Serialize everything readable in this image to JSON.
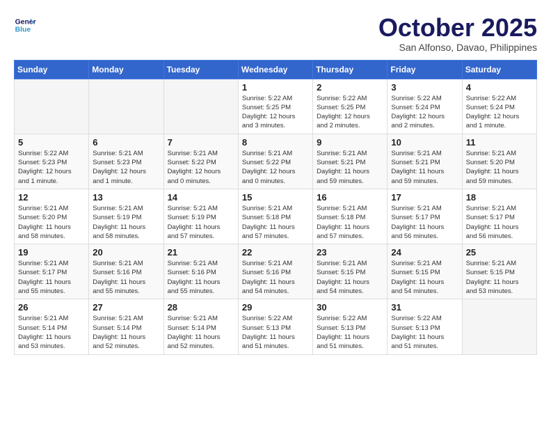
{
  "header": {
    "logo_line1": "General",
    "logo_line2": "Blue",
    "month": "October 2025",
    "location": "San Alfonso, Davao, Philippines"
  },
  "weekdays": [
    "Sunday",
    "Monday",
    "Tuesday",
    "Wednesday",
    "Thursday",
    "Friday",
    "Saturday"
  ],
  "weeks": [
    [
      {
        "day": "",
        "info": ""
      },
      {
        "day": "",
        "info": ""
      },
      {
        "day": "",
        "info": ""
      },
      {
        "day": "1",
        "info": "Sunrise: 5:22 AM\nSunset: 5:25 PM\nDaylight: 12 hours\nand 3 minutes."
      },
      {
        "day": "2",
        "info": "Sunrise: 5:22 AM\nSunset: 5:25 PM\nDaylight: 12 hours\nand 2 minutes."
      },
      {
        "day": "3",
        "info": "Sunrise: 5:22 AM\nSunset: 5:24 PM\nDaylight: 12 hours\nand 2 minutes."
      },
      {
        "day": "4",
        "info": "Sunrise: 5:22 AM\nSunset: 5:24 PM\nDaylight: 12 hours\nand 1 minute."
      }
    ],
    [
      {
        "day": "5",
        "info": "Sunrise: 5:22 AM\nSunset: 5:23 PM\nDaylight: 12 hours\nand 1 minute."
      },
      {
        "day": "6",
        "info": "Sunrise: 5:21 AM\nSunset: 5:23 PM\nDaylight: 12 hours\nand 1 minute."
      },
      {
        "day": "7",
        "info": "Sunrise: 5:21 AM\nSunset: 5:22 PM\nDaylight: 12 hours\nand 0 minutes."
      },
      {
        "day": "8",
        "info": "Sunrise: 5:21 AM\nSunset: 5:22 PM\nDaylight: 12 hours\nand 0 minutes."
      },
      {
        "day": "9",
        "info": "Sunrise: 5:21 AM\nSunset: 5:21 PM\nDaylight: 11 hours\nand 59 minutes."
      },
      {
        "day": "10",
        "info": "Sunrise: 5:21 AM\nSunset: 5:21 PM\nDaylight: 11 hours\nand 59 minutes."
      },
      {
        "day": "11",
        "info": "Sunrise: 5:21 AM\nSunset: 5:20 PM\nDaylight: 11 hours\nand 59 minutes."
      }
    ],
    [
      {
        "day": "12",
        "info": "Sunrise: 5:21 AM\nSunset: 5:20 PM\nDaylight: 11 hours\nand 58 minutes."
      },
      {
        "day": "13",
        "info": "Sunrise: 5:21 AM\nSunset: 5:19 PM\nDaylight: 11 hours\nand 58 minutes."
      },
      {
        "day": "14",
        "info": "Sunrise: 5:21 AM\nSunset: 5:19 PM\nDaylight: 11 hours\nand 57 minutes."
      },
      {
        "day": "15",
        "info": "Sunrise: 5:21 AM\nSunset: 5:18 PM\nDaylight: 11 hours\nand 57 minutes."
      },
      {
        "day": "16",
        "info": "Sunrise: 5:21 AM\nSunset: 5:18 PM\nDaylight: 11 hours\nand 57 minutes."
      },
      {
        "day": "17",
        "info": "Sunrise: 5:21 AM\nSunset: 5:17 PM\nDaylight: 11 hours\nand 56 minutes."
      },
      {
        "day": "18",
        "info": "Sunrise: 5:21 AM\nSunset: 5:17 PM\nDaylight: 11 hours\nand 56 minutes."
      }
    ],
    [
      {
        "day": "19",
        "info": "Sunrise: 5:21 AM\nSunset: 5:17 PM\nDaylight: 11 hours\nand 55 minutes."
      },
      {
        "day": "20",
        "info": "Sunrise: 5:21 AM\nSunset: 5:16 PM\nDaylight: 11 hours\nand 55 minutes."
      },
      {
        "day": "21",
        "info": "Sunrise: 5:21 AM\nSunset: 5:16 PM\nDaylight: 11 hours\nand 55 minutes."
      },
      {
        "day": "22",
        "info": "Sunrise: 5:21 AM\nSunset: 5:16 PM\nDaylight: 11 hours\nand 54 minutes."
      },
      {
        "day": "23",
        "info": "Sunrise: 5:21 AM\nSunset: 5:15 PM\nDaylight: 11 hours\nand 54 minutes."
      },
      {
        "day": "24",
        "info": "Sunrise: 5:21 AM\nSunset: 5:15 PM\nDaylight: 11 hours\nand 54 minutes."
      },
      {
        "day": "25",
        "info": "Sunrise: 5:21 AM\nSunset: 5:15 PM\nDaylight: 11 hours\nand 53 minutes."
      }
    ],
    [
      {
        "day": "26",
        "info": "Sunrise: 5:21 AM\nSunset: 5:14 PM\nDaylight: 11 hours\nand 53 minutes."
      },
      {
        "day": "27",
        "info": "Sunrise: 5:21 AM\nSunset: 5:14 PM\nDaylight: 11 hours\nand 52 minutes."
      },
      {
        "day": "28",
        "info": "Sunrise: 5:21 AM\nSunset: 5:14 PM\nDaylight: 11 hours\nand 52 minutes."
      },
      {
        "day": "29",
        "info": "Sunrise: 5:22 AM\nSunset: 5:13 PM\nDaylight: 11 hours\nand 51 minutes."
      },
      {
        "day": "30",
        "info": "Sunrise: 5:22 AM\nSunset: 5:13 PM\nDaylight: 11 hours\nand 51 minutes."
      },
      {
        "day": "31",
        "info": "Sunrise: 5:22 AM\nSunset: 5:13 PM\nDaylight: 11 hours\nand 51 minutes."
      },
      {
        "day": "",
        "info": ""
      }
    ]
  ]
}
